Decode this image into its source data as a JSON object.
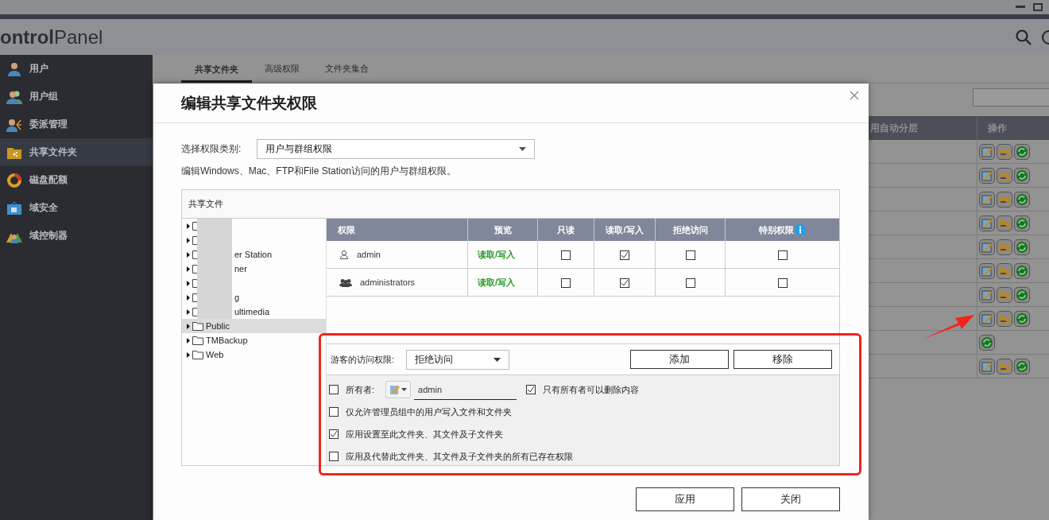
{
  "header": {
    "brand": "**ontrol**Panel"
  },
  "sidebar": {
    "items": [
      {
        "label": "用户",
        "selected": false
      },
      {
        "label": "用户组",
        "selected": false
      },
      {
        "label": "委派管理",
        "selected": false
      },
      {
        "label": "共享文件夹",
        "selected": true
      },
      {
        "label": "磁盘配额",
        "selected": false
      },
      {
        "label": "域安全",
        "selected": false
      },
      {
        "label": "域控制器",
        "selected": false
      }
    ]
  },
  "tabs": [
    {
      "label": "共享文件夹",
      "selected": true
    },
    {
      "label": "高级权限",
      "selected": false
    },
    {
      "label": "文件夹集合",
      "selected": false
    }
  ],
  "background_table": {
    "columns": [
      "用自动分层",
      "操作"
    ],
    "rows": [
      {
        "actions": [
          {
            "kind": "edit"
          },
          {
            "kind": "folder"
          },
          {
            "kind": "refresh"
          }
        ]
      },
      {
        "actions": [
          {
            "kind": "edit"
          },
          {
            "kind": "folder"
          },
          {
            "kind": "refresh"
          }
        ]
      },
      {
        "actions": [
          {
            "kind": "edit"
          },
          {
            "kind": "folder"
          },
          {
            "kind": "refresh"
          }
        ]
      },
      {
        "actions": [
          {
            "kind": "edit"
          },
          {
            "kind": "folder"
          },
          {
            "kind": "refresh"
          }
        ]
      },
      {
        "actions": [
          {
            "kind": "edit"
          },
          {
            "kind": "folder"
          },
          {
            "kind": "refresh"
          }
        ]
      },
      {
        "actions": [
          {
            "kind": "edit"
          },
          {
            "kind": "folder"
          },
          {
            "kind": "refresh"
          }
        ]
      },
      {
        "actions": [
          {
            "kind": "edit"
          },
          {
            "kind": "folder"
          },
          {
            "kind": "refresh"
          }
        ]
      },
      {
        "actions": [
          {
            "kind": "edit"
          },
          {
            "kind": "folder"
          },
          {
            "kind": "refresh"
          }
        ]
      },
      {
        "actions": [
          {
            "kind": "refresh"
          }
        ]
      },
      {
        "actions": [
          {
            "kind": "edit"
          },
          {
            "kind": "folder"
          },
          {
            "kind": "refresh"
          }
        ]
      }
    ]
  },
  "dialog": {
    "title": "编辑共享文件夹权限",
    "category_label": "选择权限类别:",
    "category_value": "用户与群组权限",
    "description": "编辑Windows、Mac、FTP和File Station访问的用户与群组权限。",
    "panel_title": "共享文件",
    "tree": [
      {
        "redacted": true,
        "selected": false
      },
      {
        "redacted": true,
        "selected": false
      },
      {
        "label": "er Station",
        "redacted": true,
        "selected": false
      },
      {
        "label": "ner",
        "redacted": true,
        "selected": false
      },
      {
        "redacted": true,
        "selected": false
      },
      {
        "label": "g",
        "redacted": true,
        "selected": false
      },
      {
        "label": "ultimedia",
        "redacted": true,
        "selected": false
      },
      {
        "label": "Public",
        "redacted": false,
        "selected": true
      },
      {
        "label": "TMBackup",
        "redacted": false,
        "selected": false
      },
      {
        "label": "Web",
        "redacted": false,
        "selected": false
      }
    ],
    "table": {
      "columns": [
        "权限",
        "预览",
        "只读",
        "读取/写入",
        "拒绝访问",
        "特别权限"
      ],
      "rows": [
        {
          "kind": "user",
          "name": "admin",
          "preview": "读取/写入",
          "read_only": false,
          "read_write": true,
          "deny": false,
          "special": false
        },
        {
          "kind": "group",
          "name": "administrators",
          "preview": "读取/写入",
          "read_only": false,
          "read_write": true,
          "deny": false,
          "special": false
        }
      ]
    },
    "guest_label": "游客的访问权限:",
    "guest_value": "拒绝访问",
    "action_buttons": [
      "添加",
      "移除"
    ],
    "owner": {
      "checked": false,
      "label": "所有者:",
      "value": "admin"
    },
    "owner_only_delete": {
      "checked": true,
      "label": "只有所有者可以删除内容"
    },
    "options": [
      {
        "label": "仅允许管理员组中的用户写入文件和文件夹",
        "checked": false
      },
      {
        "label": "应用设置至此文件夹、其文件及子文件夹",
        "checked": true
      },
      {
        "label": "应用及代替此文件夹、其文件及子文件夹的所有已存在权限",
        "checked": false
      }
    ],
    "footer_buttons": [
      "应用",
      "关闭"
    ]
  }
}
